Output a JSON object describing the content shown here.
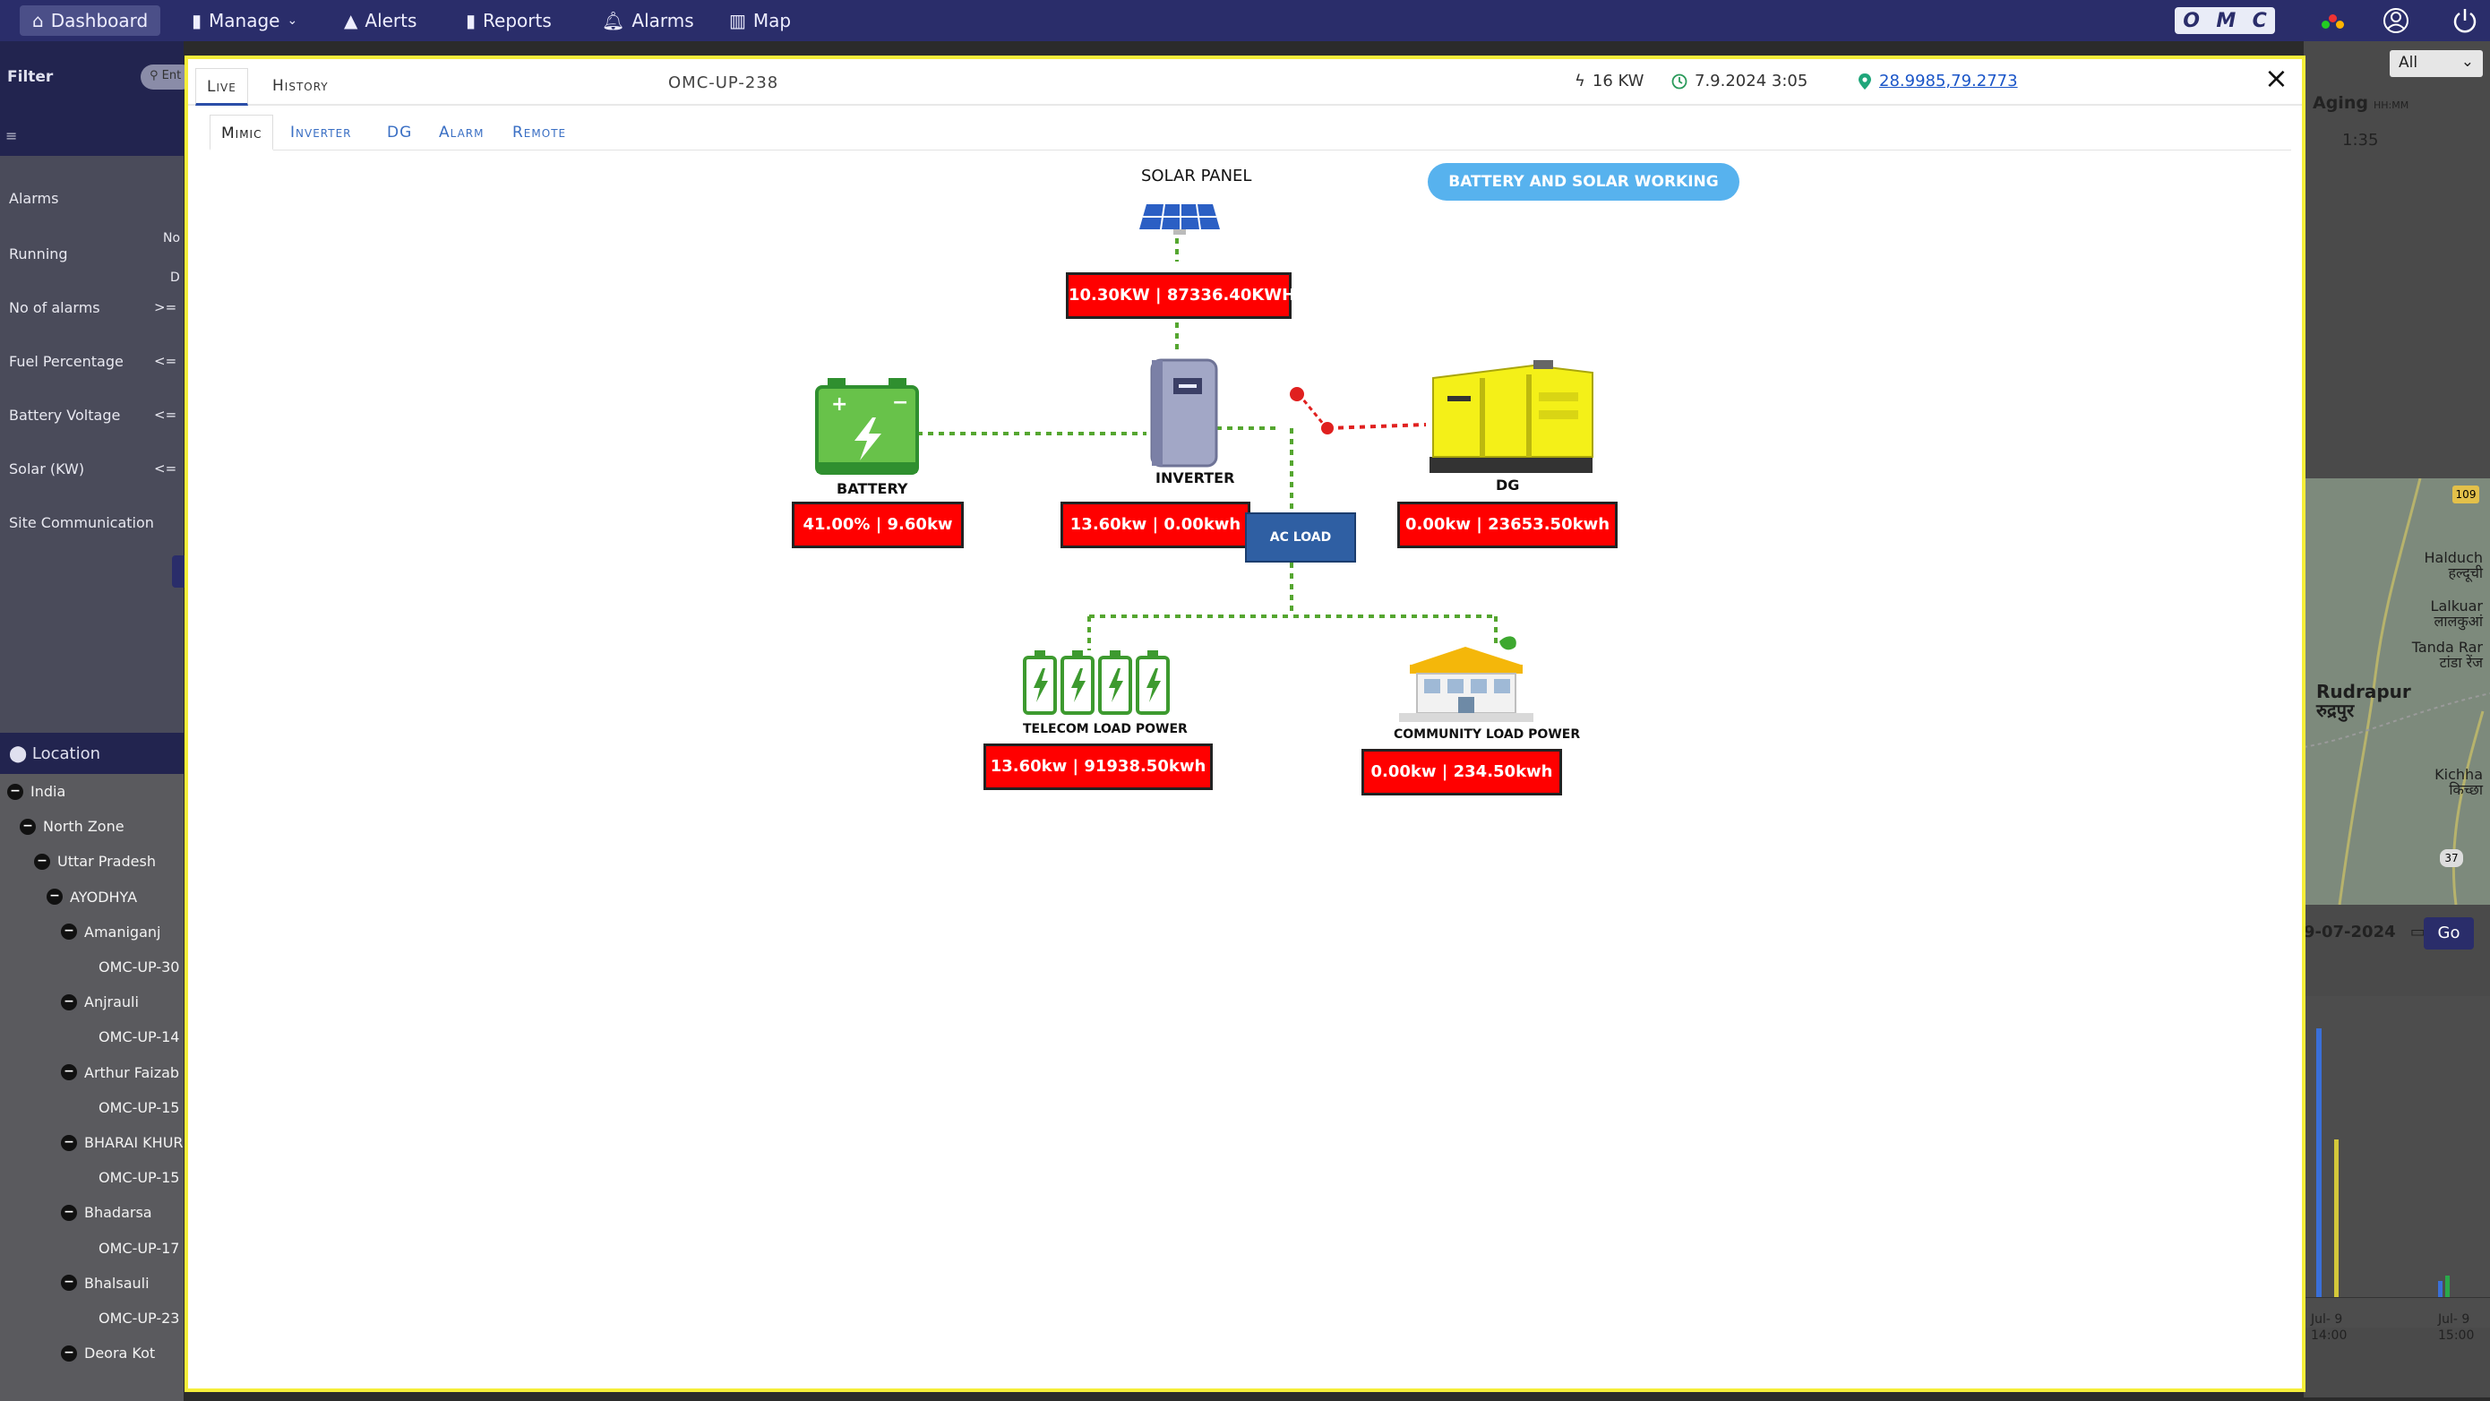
{
  "nav": {
    "items": [
      {
        "label": "Dashboard",
        "icon": "home-icon"
      },
      {
        "label": "Manage",
        "icon": "columns-icon"
      },
      {
        "label": "Alerts",
        "icon": "warning-icon"
      },
      {
        "label": "Reports",
        "icon": "clipboard-icon"
      },
      {
        "label": "Alarms",
        "icon": "bell-icon"
      },
      {
        "label": "Map",
        "icon": "map-icon"
      }
    ],
    "logo": [
      "O",
      "M",
      "C"
    ]
  },
  "sidebar": {
    "filter_label": "Filter",
    "search_placeholder": "Ent",
    "filters": [
      {
        "label": "Alarms",
        "op": ""
      },
      {
        "label": "Running",
        "op": ""
      },
      {
        "label": "No of alarms",
        "op": ">="
      },
      {
        "label": "Fuel Percentage",
        "op": "<="
      },
      {
        "label": "Battery Voltage",
        "op": "<="
      },
      {
        "label": "Solar (KW)",
        "op": "<="
      },
      {
        "label": "Site Communication",
        "op": ""
      }
    ],
    "running_fragments": [
      "No",
      "D"
    ],
    "location_label": "Location",
    "tree": [
      {
        "label": "India",
        "level": 0,
        "expandable": true
      },
      {
        "label": "North Zone",
        "level": 1,
        "expandable": true
      },
      {
        "label": "Uttar Pradesh",
        "level": 2,
        "expandable": true
      },
      {
        "label": "AYODHYA",
        "level": 3,
        "expandable": true
      },
      {
        "label": "Amaniganj",
        "level": 4,
        "expandable": true
      },
      {
        "label": "OMC-UP-30",
        "level": 5,
        "expandable": false
      },
      {
        "label": "Anjrauli",
        "level": 4,
        "expandable": true
      },
      {
        "label": "OMC-UP-14",
        "level": 5,
        "expandable": false
      },
      {
        "label": "Arthur Faizab",
        "level": 4,
        "expandable": true
      },
      {
        "label": "OMC-UP-15",
        "level": 5,
        "expandable": false
      },
      {
        "label": "BHARAI KHUR",
        "level": 4,
        "expandable": true
      },
      {
        "label": "OMC-UP-15",
        "level": 5,
        "expandable": false
      },
      {
        "label": "Bhadarsa",
        "level": 4,
        "expandable": true
      },
      {
        "label": "OMC-UP-17",
        "level": 5,
        "expandable": false
      },
      {
        "label": "Bhalsauli",
        "level": 4,
        "expandable": true
      },
      {
        "label": "OMC-UP-23",
        "level": 5,
        "expandable": false
      },
      {
        "label": "Deora Kot",
        "level": 4,
        "expandable": true
      }
    ]
  },
  "right": {
    "select_value": "All",
    "aging_label": "Aging",
    "aging_unit": "HH:MM",
    "aging_value": "1:35",
    "map_labels": [
      {
        "text": "Halduch\nहल्दूची"
      },
      {
        "text": "Lalkuar\nलालकुआं"
      },
      {
        "text": "Tanda Rar\nटांडा रेंज"
      },
      {
        "text": "Rudrapur\nरुद्रपुर"
      },
      {
        "text": "Kichha\nकिच्छा"
      }
    ],
    "map_road_top": "109",
    "map_road_bottom": "37",
    "date_value": "9-07-2024",
    "go_label": "Go",
    "axis_labels": [
      {
        "line1": "Jul- 9",
        "line2": "14:00"
      },
      {
        "line1": "Jul- 9",
        "line2": "15:00"
      }
    ]
  },
  "modal": {
    "tabs": [
      "Live",
      "History"
    ],
    "active_tab": "Live",
    "site_id": "OMC-UP-238",
    "power": "16 KW",
    "timestamp": "7.9.2024 3:05",
    "location_link": "28.9985,79.2773",
    "close_label": "×",
    "subtabs": [
      "Mimic",
      "Inverter",
      "DG",
      "Alarm",
      "Remote"
    ],
    "active_subtab": "Mimic"
  },
  "mimic": {
    "solar_label": "SOLAR PANEL",
    "solar_value": "10.30KW | 87336.40KWH",
    "mode_label": "BATTERY AND SOLAR WORKING MODE",
    "battery_label": "BATTERY",
    "battery_value": "41.00% | 9.60kw",
    "inverter_label": "INVERTER",
    "inverter_value": "13.60kw | 0.00kwh",
    "acload_label": "AC LOAD",
    "dg_label": "DG",
    "dg_value": "0.00kw | 23653.50kwh",
    "telecom_label": "TELECOM LOAD POWER",
    "telecom_value": "13.60kw | 91938.50kwh",
    "community_label": "COMMUNITY LOAD POWER",
    "community_value": "0.00kw | 234.50kwh"
  },
  "colors": {
    "nav_bg": "#2a2d6a",
    "highlight_border": "#f5ee3a",
    "value_box": "#ff0000",
    "green_line": "#55a630",
    "red_line": "#e0201f",
    "mode_badge": "#57b2ee"
  }
}
